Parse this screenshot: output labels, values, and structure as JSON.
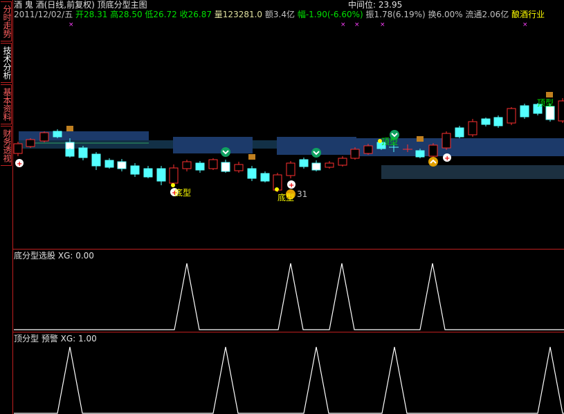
{
  "sidebar": {
    "tabs": [
      {
        "label": "分时走势"
      },
      {
        "label": "技术分析"
      },
      {
        "label": "基本资料"
      },
      {
        "label": "财务透视"
      }
    ]
  },
  "header": {
    "title": "酒 鬼 酒(日线,前复权) 顶底分型主图",
    "mid_label": "中间位: 23.95",
    "date": "2011/12/02/五",
    "open": "开28.31",
    "high": "高28.50",
    "low": "低26.72",
    "close": "收26.87",
    "volume": "量123281.0",
    "amount": "额3.4亿",
    "change": "幅-1.90(-6.60%)",
    "amplitude": "振1.78(6.19%)",
    "turnover": "换6.00%",
    "float": "流通2.06亿",
    "industry": "酿酒行业"
  },
  "main_chart": {
    "labels": {
      "bottom1": "底型",
      "bottom2": "底型",
      "top1": "顶型",
      "top2": "顶型",
      "price_marker": "31"
    }
  },
  "panel2": {
    "title": "底分型选股",
    "value": "XG: 0.00"
  },
  "panel3": {
    "title": "顶分型 预警",
    "value": "XG: 1.00"
  },
  "colors": {
    "up": "#ff3030",
    "down": "#54ffff",
    "header_green": "#00e000",
    "header_yellow": "#ffff00",
    "band": "#1a3a66",
    "grid": "#c02020"
  }
}
